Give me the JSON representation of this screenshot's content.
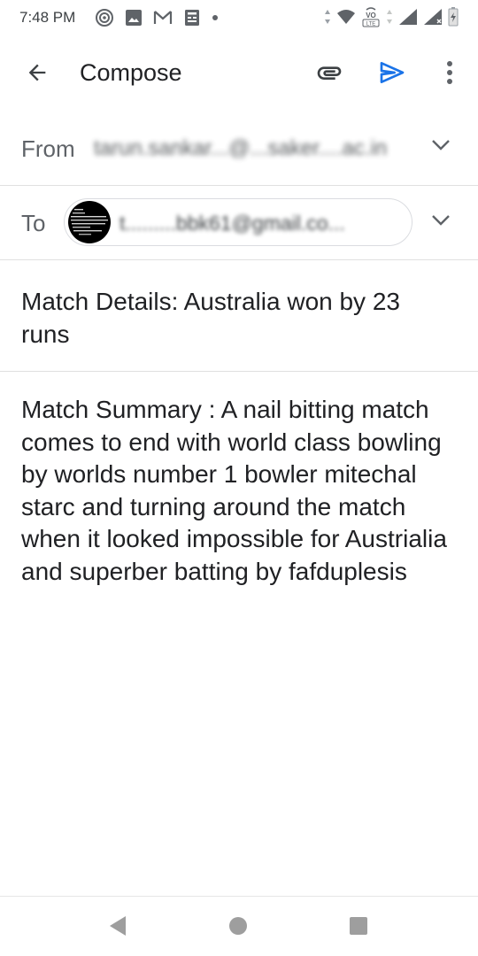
{
  "status_bar": {
    "time": "7:48 PM",
    "left_icons": [
      "music-recognition-icon",
      "image-icon",
      "gmail-icon",
      "news-icon",
      "dot-icon"
    ],
    "right_icons": [
      "data-arrows-icon",
      "wifi-icon",
      "volte-icon",
      "signal-icon",
      "signal-icon",
      "battery-icon"
    ],
    "volte_label": "VoLTE"
  },
  "app_bar": {
    "title": "Compose",
    "icons": {
      "back": "arrow-back-icon",
      "attach": "paperclip-icon",
      "send": "send-icon",
      "more": "more-vert-icon"
    }
  },
  "colors": {
    "accent": "#1a73e8",
    "text_primary": "#202124",
    "text_secondary": "#5f6368",
    "divider": "#e0e0e0",
    "nav_icon": "#9e9e9e"
  },
  "compose": {
    "from": {
      "label": "From",
      "value": "tarun.sankar...@...saker....ac.in"
    },
    "to": {
      "label": "To",
      "recipient": "t.........bbk61@gmail.co..."
    },
    "subject": "Match Details: Australia won by 23 runs",
    "body": "Match Summary : A nail bitting match comes to end with world class bowling by worlds number 1 bowler mitechal starc and turning around the match when it looked impossible for Austrialia and superber batting by fafduplesis"
  },
  "nav_bar": {
    "icons": [
      "nav-back-icon",
      "nav-home-icon",
      "nav-recents-icon"
    ]
  }
}
